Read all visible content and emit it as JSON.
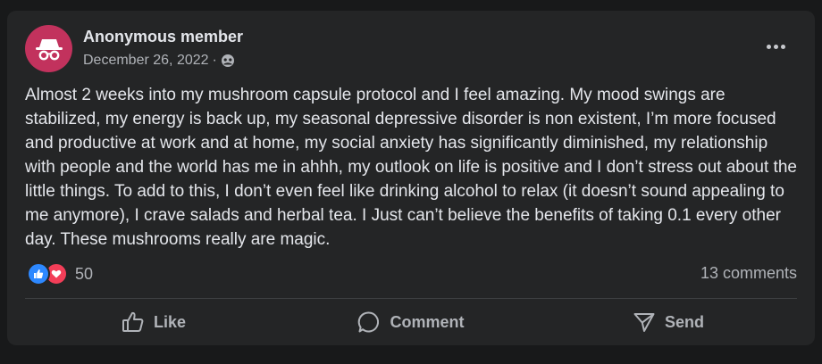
{
  "post": {
    "author": "Anonymous member",
    "date": "December 26, 2022",
    "separator": "·",
    "audience_icon": "group-audience-icon",
    "avatar_icon": "anonymous-incognito-icon",
    "avatar_color": "#c2325d",
    "text": "Almost 2 weeks into my mushroom capsule protocol and I feel amazing. My mood swings are stabilized, my energy is back up, my seasonal depressive disorder is non existent, I’m more focused and productive at work and at home, my social anxiety has significantly diminished, my relationship with people and the world has me in ahhh, my outlook on life is positive and I don’t stress out about the little things. To add to this, I don’t even feel like drinking alcohol to relax (it doesn’t sound appealing to me anymore), I crave salads and herbal tea. I Just can’t believe the benefits of taking 0.1 every other day. These mushrooms really are magic."
  },
  "stats": {
    "reaction_count": "50",
    "reaction_icons": [
      "like-reaction-icon",
      "love-reaction-icon"
    ],
    "comments": "13 comments"
  },
  "actions": {
    "like": "Like",
    "comment": "Comment",
    "send": "Send"
  },
  "colors": {
    "background": "#18191a",
    "card": "#242526",
    "text_primary": "#e4e6eb",
    "text_secondary": "#b0b3b8",
    "like_blue": "#2d88ff",
    "love_red": "#f33e58"
  }
}
